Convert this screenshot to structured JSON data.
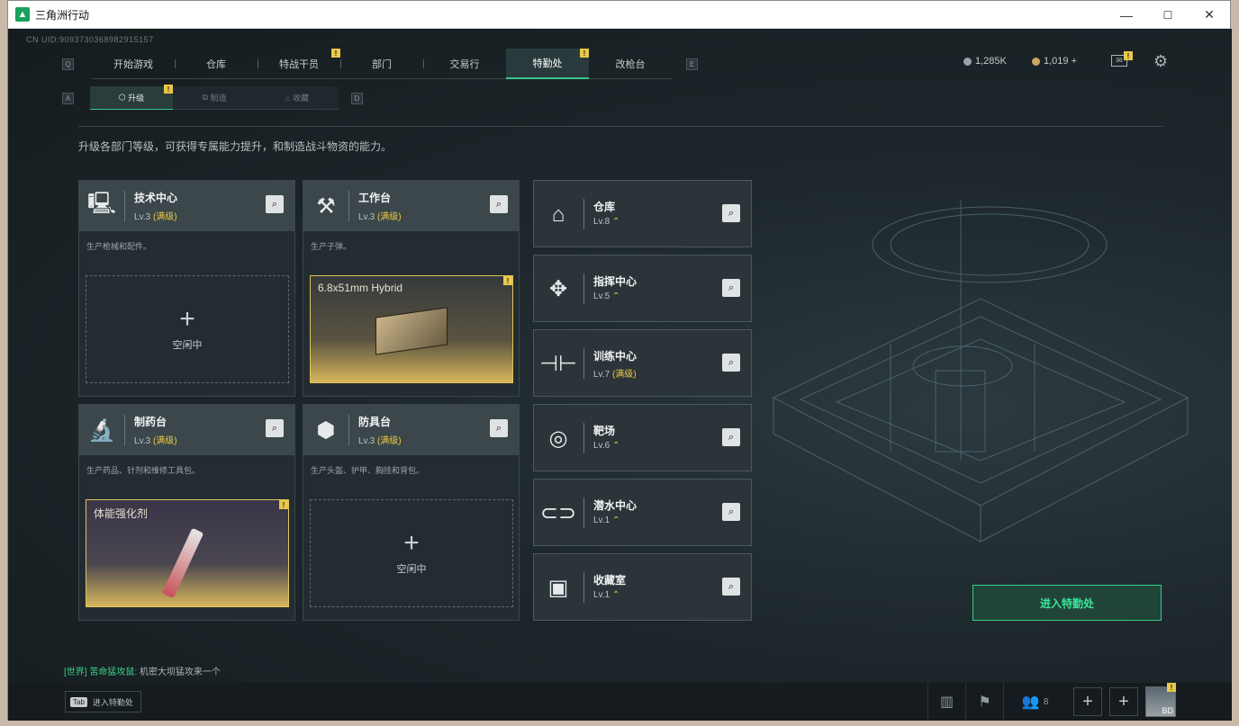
{
  "window": {
    "title": "三角洲行动",
    "minimize": "—",
    "maximize": "☐",
    "close": "✕"
  },
  "uid": "CN UID:9093730368982915157",
  "nav": {
    "key_left": "Q",
    "key_right": "E",
    "tabs": [
      "开始游戏",
      "仓库",
      "特战干员",
      "部门",
      "交易行",
      "特勤处",
      "改枪台"
    ],
    "active": "特勤处"
  },
  "currency": {
    "silver": "1,285K",
    "gold": "1,019 +"
  },
  "subnav": {
    "key_left": "A",
    "key_right": "D",
    "tabs": [
      "升级",
      "制造",
      "收藏"
    ],
    "active": "升级"
  },
  "description": "升级各部门等级，可获得专属能力提升，和制造战斗物资的能力。",
  "cards": [
    {
      "name": "技术中心",
      "level": "Lv.3",
      "max": "(满级)",
      "desc": "生产枪械和配件。",
      "slot": "空闲中"
    },
    {
      "name": "工作台",
      "level": "Lv.3",
      "max": "(满级)",
      "desc": "生产子弹。",
      "item": "6.8x51mm Hybrid"
    },
    {
      "name": "制药台",
      "level": "Lv.3",
      "max": "(满级)",
      "desc": "生产药品、针剂和维修工具包。",
      "item": "体能强化剂"
    },
    {
      "name": "防具台",
      "level": "Lv.3",
      "max": "(满级)",
      "desc": "生产头盔、护甲、胸挂和背包。",
      "slot": "空闲中"
    }
  ],
  "right_cards": [
    {
      "name": "仓库",
      "level": "Lv.8",
      "up": "⌃"
    },
    {
      "name": "指挥中心",
      "level": "Lv.5",
      "up": "⌃"
    },
    {
      "name": "训练中心",
      "level": "Lv.7",
      "max": "(满级)"
    },
    {
      "name": "靶场",
      "level": "Lv.6",
      "up": "⌃"
    },
    {
      "name": "潜水中心",
      "level": "Lv.1",
      "up": "⌃"
    },
    {
      "name": "收藏室",
      "level": "Lv.1",
      "up": "⌃"
    }
  ],
  "enter_button": "进入特勤处",
  "chat": {
    "channel": "[世界] 苦命猛攻鼠:",
    "message": "机密大坝猛攻来一个"
  },
  "bottom": {
    "tab_key": "Tab",
    "tab_label": "进入特勤处",
    "friends": "8",
    "avatar_label": "BD"
  },
  "badge": "!"
}
